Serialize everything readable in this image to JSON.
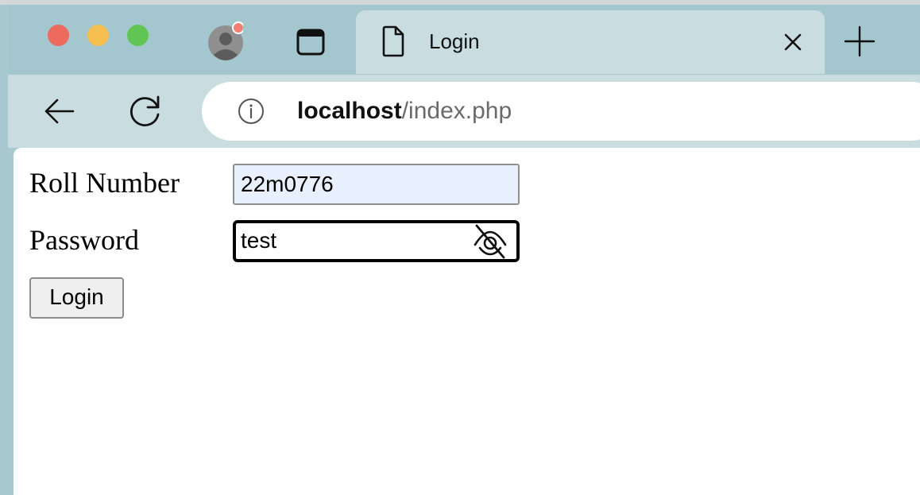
{
  "browser": {
    "tab": {
      "title": "Login",
      "icon": "document-icon"
    },
    "address_bar": {
      "host": "localhost",
      "path": "/index.php",
      "icon": "info-icon"
    },
    "controls": {
      "back_icon": "arrow-left-icon",
      "reload_icon": "reload-icon",
      "new_tab_icon": "plus-icon",
      "close_tab_icon": "close-icon"
    },
    "traffic_lights": [
      "#ec6a5e",
      "#f4bf4f",
      "#61c554"
    ]
  },
  "form": {
    "roll_number": {
      "label": "Roll Number",
      "value": "22m0776"
    },
    "password": {
      "label": "Password",
      "value": "test",
      "toggle_icon": "eye-slash-icon"
    },
    "submit_label": "Login"
  },
  "colors": {
    "autofill_background": "#e8f0fe",
    "chrome_background": "#a4c6ce",
    "toolbar_background": "#c9dde1"
  }
}
